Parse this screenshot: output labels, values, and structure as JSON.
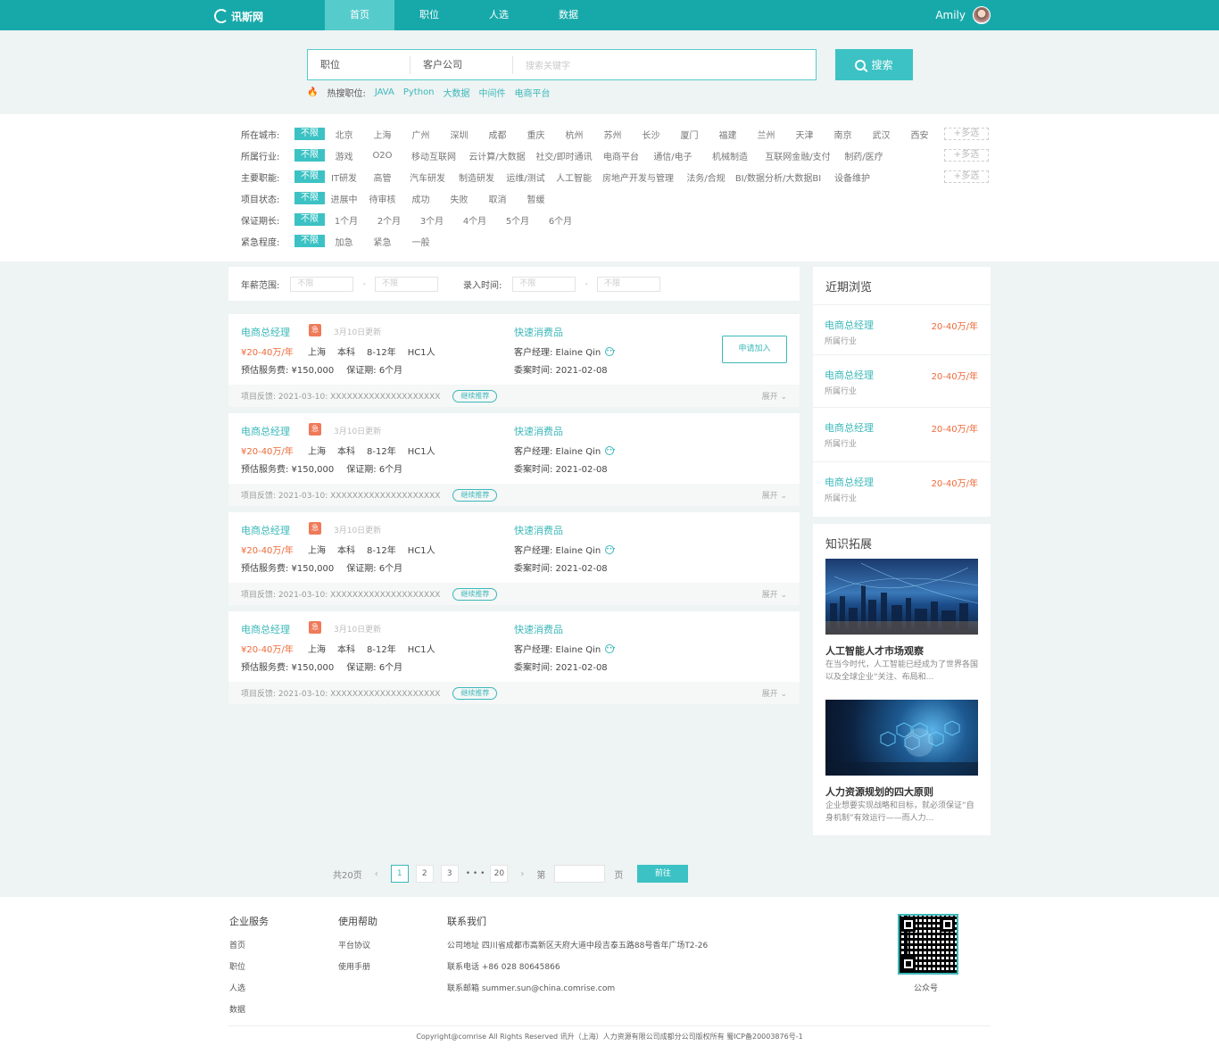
{
  "header": {
    "logo_text": "讯斯网",
    "nav": [
      "首页",
      "职位",
      "人选",
      "数据"
    ],
    "user_name": "Amily"
  },
  "search": {
    "select1": "职位",
    "select2": "客户公司",
    "placeholder": "搜索关键字",
    "button": "搜索",
    "hot_label": "热搜职位:",
    "hot_tags": [
      "JAVA",
      "Python",
      "大数据",
      "中间件",
      "电商平台"
    ]
  },
  "filters": {
    "rows": [
      {
        "label": "所在城市:",
        "options": [
          "不限",
          "北京",
          "上海",
          "广州",
          "深圳",
          "成都",
          "重庆",
          "杭州",
          "苏州",
          "长沙",
          "厦门",
          "福建",
          "兰州",
          "天津",
          "南京",
          "武汉",
          "西安"
        ],
        "multi": "+多选"
      },
      {
        "label": "所属行业:",
        "options": [
          "不限",
          "游戏",
          "O2O",
          "移动互联网",
          "云计算/大数据",
          "社交/即时通讯",
          "电商平台",
          "通信/电子",
          "机械制造",
          "互联网金融/支付",
          "制药/医疗"
        ],
        "multi": "+多选"
      },
      {
        "label": "主要职能:",
        "options": [
          "不限",
          "IT研发",
          "高管",
          "汽车研发",
          "制造研发",
          "运维/测试",
          "人工智能",
          "房地产开发与管理",
          "法务/合规",
          "BI/数据分析/大数据BI",
          "设备维护"
        ],
        "multi": "+多选"
      },
      {
        "label": "项目状态:",
        "options": [
          "不限",
          "进展中",
          "待审核",
          "成功",
          "失败",
          "取消",
          "暂缓"
        ]
      },
      {
        "label": "保证期长:",
        "options": [
          "不限",
          "1个月",
          "2个月",
          "3个月",
          "4个月",
          "5个月",
          "6个月"
        ]
      },
      {
        "label": "紧急程度:",
        "options": [
          "不限",
          "加急",
          "紧急",
          "一般"
        ]
      }
    ]
  },
  "salary_bar": {
    "salary_label": "年薪范围:",
    "time_label": "录入时间:",
    "unlimited": "不限",
    "dash": "-"
  },
  "jobs": [
    {
      "title": "电商总经理",
      "urgent": "急",
      "updated": "3月10日更新",
      "pay": "¥20-40万/年",
      "city": "上海",
      "edu": "本科",
      "exp": "8-12年",
      "hc": "HC1人",
      "fee": "预估服务费: ¥150,000",
      "guarantee": "保证期: 6个月",
      "company": "快速消费品",
      "manager": "客户经理: Elaine Qin",
      "date": "委案时间: 2021-02-08",
      "apply": "申请加入",
      "feedback": "项目反馈: 2021-03-10: XXXXXXXXXXXXXXXXXXXX",
      "continue": "继续推荐",
      "expand": "展开"
    },
    {
      "title": "电商总经理",
      "urgent": "急",
      "updated": "3月10日更新",
      "pay": "¥20-40万/年",
      "city": "上海",
      "edu": "本科",
      "exp": "8-12年",
      "hc": "HC1人",
      "fee": "预估服务费: ¥150,000",
      "guarantee": "保证期: 6个月",
      "company": "快速消费品",
      "manager": "客户经理: Elaine Qin",
      "date": "委案时间: 2021-02-08",
      "apply": "",
      "feedback": "项目反馈: 2021-03-10: XXXXXXXXXXXXXXXXXXXX",
      "continue": "继续推荐",
      "expand": "展开"
    },
    {
      "title": "电商总经理",
      "urgent": "急",
      "updated": "3月10日更新",
      "pay": "¥20-40万/年",
      "city": "上海",
      "edu": "本科",
      "exp": "8-12年",
      "hc": "HC1人",
      "fee": "预估服务费: ¥150,000",
      "guarantee": "保证期: 6个月",
      "company": "快速消费品",
      "manager": "客户经理: Elaine Qin",
      "date": "委案时间: 2021-02-08",
      "apply": "",
      "feedback": "项目反馈: 2021-03-10: XXXXXXXXXXXXXXXXXXXX",
      "continue": "继续推荐",
      "expand": "展开"
    },
    {
      "title": "电商总经理",
      "urgent": "急",
      "updated": "3月10日更新",
      "pay": "¥20-40万/年",
      "city": "上海",
      "edu": "本科",
      "exp": "8-12年",
      "hc": "HC1人",
      "fee": "预估服务费: ¥150,000",
      "guarantee": "保证期: 6个月",
      "company": "快速消费品",
      "manager": "客户经理: Elaine Qin",
      "date": "委案时间: 2021-02-08",
      "apply": "",
      "feedback": "项目反馈: 2021-03-10: XXXXXXXXXXXXXXXXXXXX",
      "continue": "继续推荐",
      "expand": "展开"
    }
  ],
  "recent": {
    "title": "近期浏览",
    "items": [
      {
        "title": "电商总经理",
        "pay": "20-40万/年",
        "sub": "所属行业"
      },
      {
        "title": "电商总经理",
        "pay": "20-40万/年",
        "sub": "所属行业"
      },
      {
        "title": "电商总经理",
        "pay": "20-40万/年",
        "sub": "所属行业"
      },
      {
        "title": "电商总经理",
        "pay": "20-40万/年",
        "sub": "所属行业"
      }
    ]
  },
  "knowledge": {
    "title": "知识拓展",
    "articles": [
      {
        "title": "人工智能人才市场观察",
        "desc": "在当今时代，人工智能已经成为了世界各国以及全球企业“关注、布局和..."
      },
      {
        "title": "人力资源规划的四大原则",
        "desc": "企业想要实现战略和目标，就必须保证“自身机制”有效运行——而人力..."
      }
    ]
  },
  "pager": {
    "total": "共20页",
    "pages": [
      "1",
      "2",
      "3"
    ],
    "ellipsis": "• • •",
    "last": "20",
    "prefix": "第",
    "suffix": "页",
    "go": "前往"
  },
  "footer": {
    "col1": {
      "head": "企业服务",
      "links": [
        "首页",
        "职位",
        "人选",
        "数据"
      ]
    },
    "col2": {
      "head": "使用帮助",
      "links": [
        "平台协议",
        "使用手册"
      ]
    },
    "col3": {
      "head": "联系我们",
      "lines": [
        "公司地址  四川省成都市高新区天府大道中段吉泰五路88号香年广场T2-26",
        "联系电话  +86 028 80645866",
        "联系邮箱  summer.sun@china.comrise.com"
      ]
    },
    "qr_label": "公众号",
    "copyright": "Copyright@comrise All Rights Reserved 讯升（上海）人力资源有限公司成都分公司版权所有 蜀ICP备20003876号-1"
  },
  "colors": {
    "accent": "#17a9aa",
    "button": "#3cc2c4",
    "highlight": "#ef6a3a"
  }
}
